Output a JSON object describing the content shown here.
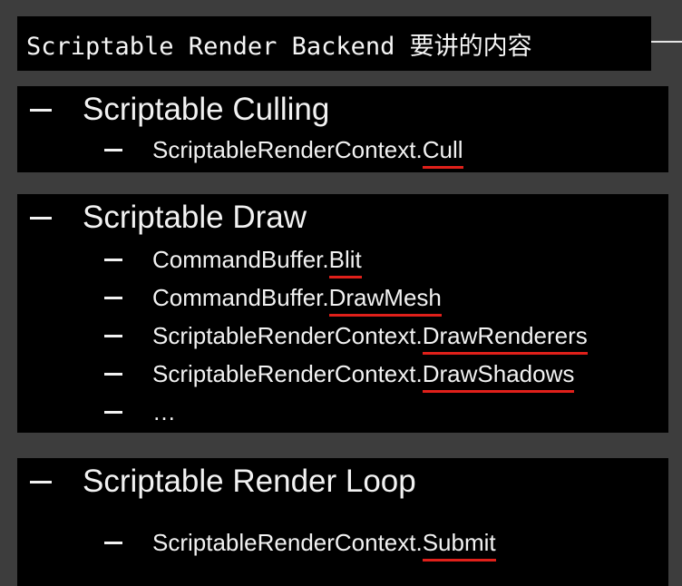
{
  "title": "Scriptable Render Backend 要讲的内容",
  "sections": [
    {
      "heading": "Scriptable Culling",
      "items": [
        {
          "prefix": "ScriptableRenderContext.",
          "method": "Cull"
        }
      ]
    },
    {
      "heading": "Scriptable Draw",
      "items": [
        {
          "prefix": "CommandBuffer.",
          "method": "Blit"
        },
        {
          "prefix": "CommandBuffer.",
          "method": "DrawMesh"
        },
        {
          "prefix": "ScriptableRenderContext.",
          "method": "DrawRenderers"
        },
        {
          "prefix": "ScriptableRenderContext.",
          "method": "DrawShadows"
        },
        {
          "prefix": "…",
          "method": ""
        }
      ]
    },
    {
      "heading": "Scriptable Render Loop",
      "items": [
        {
          "prefix": "ScriptableRenderContext.",
          "method": "Submit"
        }
      ]
    }
  ],
  "colors": {
    "background": "#3d3d3d",
    "panel": "#000000",
    "text": "#f2f2f2",
    "underline": "#e0201a"
  }
}
